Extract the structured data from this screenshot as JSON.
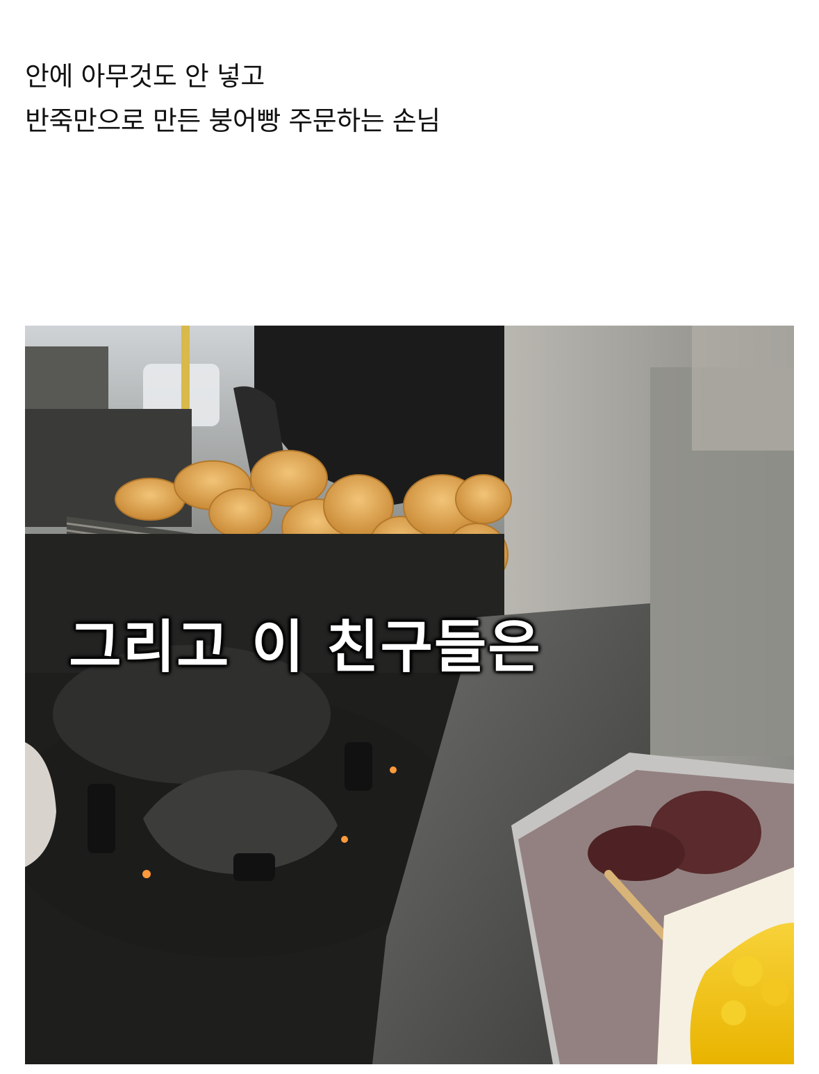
{
  "post": {
    "line1": "안에 아무것도 안 넣고",
    "line2": "반죽만으로 만든 붕어빵 주문하는 손님"
  },
  "video": {
    "caption": "그리고 이 친구들은"
  },
  "colors": {
    "background": "#ffffff",
    "text": "#111111",
    "caption": "#ffffff",
    "pastry": "#e2a850",
    "grill": "#2a2a28",
    "red_bean": "#5a2a2c",
    "custard": "#f2c200"
  }
}
